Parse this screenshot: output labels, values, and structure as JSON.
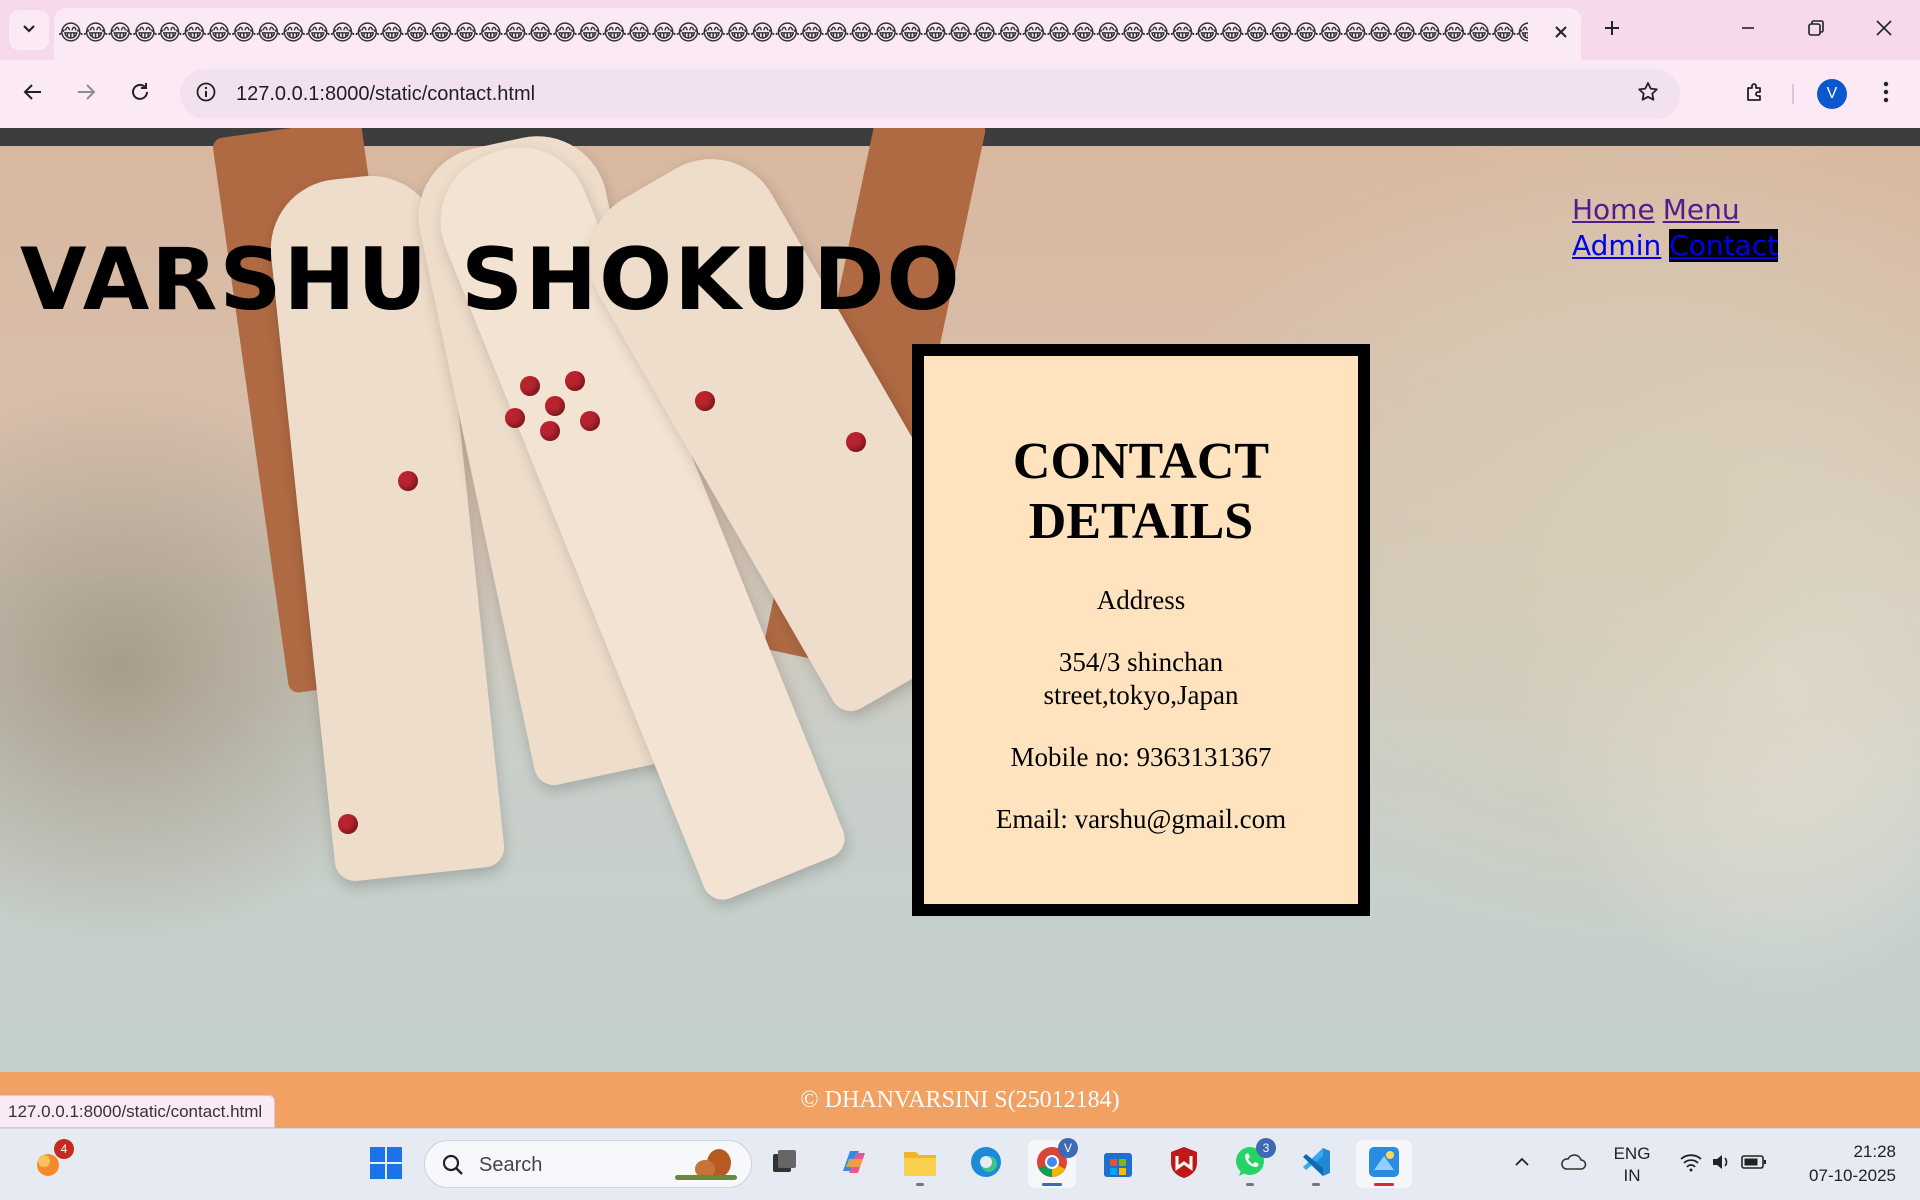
{
  "browser": {
    "tab_title": "😂😂😂😂😂😂😂😂😂😂😂😂😂😂😂😂😂😂😂😂😂😂😂😂😂😂😂😂😂😂😂😂😂😂😂😂😂😂😂😂😂😂😂😂😂😂😂😂😂😂😂😂😂😂😂😂😂😂😂😂",
    "url": "127.0.0.1:8000/static/contact.html",
    "profile_initial": "V",
    "status_url": "127.0.0.1:8000/static/contact.html"
  },
  "site": {
    "title": "VARSHU SHOKUDO",
    "nav": [
      "Home",
      "Menu",
      "Admin",
      "Contact"
    ],
    "contact": {
      "heading_line1": "CONTACT",
      "heading_line2": "DETAILS",
      "address_label": "Address",
      "address_line1": "354/3 shinchan",
      "address_line2": "street,tokyo,Japan",
      "mobile": "Mobile no: 9363131367",
      "email": "Email: varshu@gmail.com"
    },
    "footer": "© DHANVARSINI S(25012184)"
  },
  "taskbar": {
    "search_placeholder": "Search",
    "badges": {
      "notifications": "4",
      "chrome": "V",
      "whatsapp": "3"
    },
    "lang_line1": "ENG",
    "lang_line2": "IN",
    "time": "21:28",
    "date": "07-10-2025"
  },
  "icons": [
    "tab-list-icon",
    "close-icon",
    "plus-icon",
    "minimize-icon",
    "restore-icon",
    "back-icon",
    "forward-icon",
    "reload-icon",
    "info-icon",
    "star-icon",
    "extensions-icon",
    "more-icon",
    "windows-icon",
    "search-icon"
  ]
}
